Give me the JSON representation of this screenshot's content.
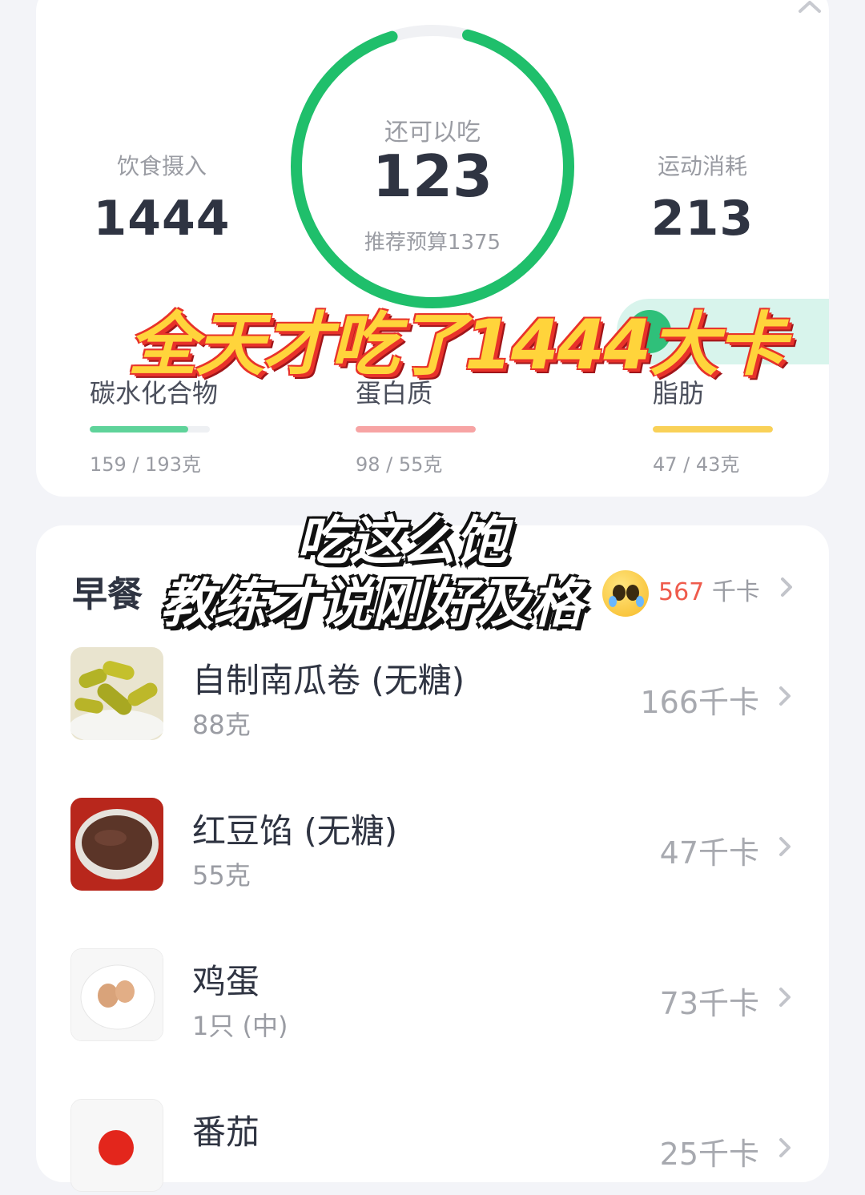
{
  "summary": {
    "intake_label": "饮食摄入",
    "intake_value": "1444",
    "remaining_label": "还可以吃",
    "remaining_value": "123",
    "budget_text": "推荐预算1375",
    "burn_label": "运动消耗",
    "burn_value": "213",
    "ring_progress": 0.91,
    "ring_color": "#1fbf6b"
  },
  "overlays": {
    "line1": "全天才吃了1444大卡",
    "line2": "吃这么饱",
    "line3": "教练才说刚好及格"
  },
  "macros": [
    {
      "name": "碳水化合物",
      "amount": "159 / 193克",
      "progress": 0.82,
      "color": "#5fd39a"
    },
    {
      "name": "蛋白质",
      "amount": "98 / 55克",
      "progress": 1.0,
      "color": "#f7a4a4"
    },
    {
      "name": "脂肪",
      "amount": "47 / 43克",
      "progress": 1.0,
      "color": "#f9d158"
    }
  ],
  "meal": {
    "title": "早餐",
    "total_kcal": "567",
    "kcal_unit": "千卡",
    "items": [
      {
        "name": "自制南瓜卷 (无糖)",
        "amount": "88克",
        "kcal": "166千卡",
        "thumb_icon": "pumpkin-roll-icon"
      },
      {
        "name": "红豆馅 (无糖)",
        "amount": "55克",
        "kcal": "47千卡",
        "thumb_icon": "red-bean-paste-icon"
      },
      {
        "name": "鸡蛋",
        "amount": "1只 (中)",
        "kcal": "73千卡",
        "thumb_icon": "egg-icon"
      },
      {
        "name": "番茄",
        "amount": "",
        "kcal": "25千卡",
        "thumb_icon": "tomato-icon"
      }
    ]
  }
}
